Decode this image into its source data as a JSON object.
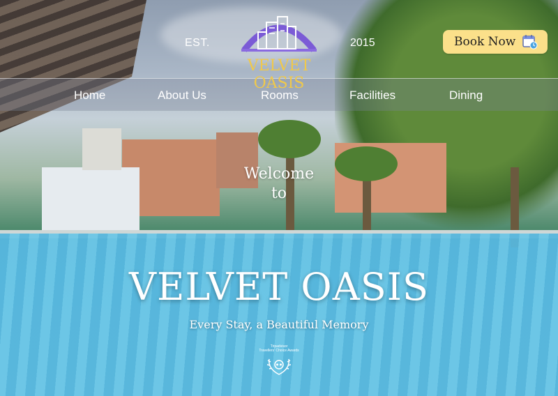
{
  "header": {
    "est_label": "EST.",
    "year": "2015",
    "brand": "VELVET OASIS",
    "logo_icon": "city-skyline-icon",
    "book_button": {
      "label": "Book Now",
      "icon": "calendar-clock-icon"
    }
  },
  "nav": {
    "items": [
      "Home",
      "About Us",
      "Rooms",
      "Facilities",
      "Dining"
    ]
  },
  "hero": {
    "welcome_line1": "Welcome",
    "welcome_line2": "to",
    "title": "VELVET OASIS",
    "tagline": "Every Stay, a Beautiful Memory",
    "award": {
      "icon": "tripadvisor-award-icon",
      "text_line1": "Tripadvisor",
      "text_line2": "Travellers' Choice Awards"
    }
  },
  "colors": {
    "brand_gold": "#f0c94b",
    "button_bg": "#fbe08a",
    "logo_purple": "#7b5bd6"
  }
}
